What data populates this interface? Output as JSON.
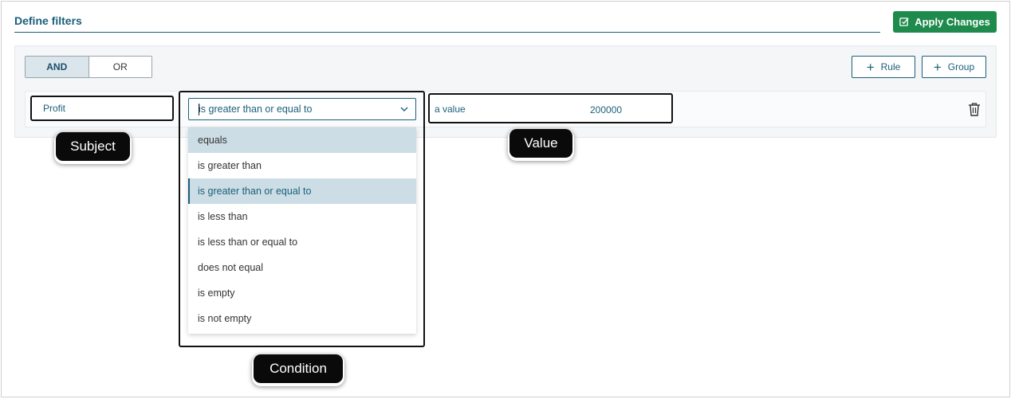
{
  "header": {
    "title": "Define filters",
    "apply_label": "Apply Changes"
  },
  "logic": {
    "and_label": "AND",
    "or_label": "OR",
    "active": "AND"
  },
  "actions": {
    "rule_label": "Rule",
    "group_label": "Group"
  },
  "rule": {
    "subject": "Profit",
    "condition": "is greater than or equal to",
    "value_placeholder": "a value",
    "value": "200000"
  },
  "condition_options": [
    "equals",
    "is greater than",
    "is greater than or equal to",
    "is less than",
    "is less than or equal to",
    "does not equal",
    "is empty",
    "is not empty"
  ],
  "callouts": {
    "subject": "Subject",
    "condition": "Condition",
    "value": "Value"
  },
  "icons": {
    "apply": "checkbox-edit-icon",
    "add": "plus-icon",
    "chevron": "chevron-down-icon",
    "delete": "trash-icon"
  },
  "colors": {
    "accent": "#1a5f7a",
    "apply_button": "#1e8a4c",
    "highlight": "#ccdde5"
  }
}
